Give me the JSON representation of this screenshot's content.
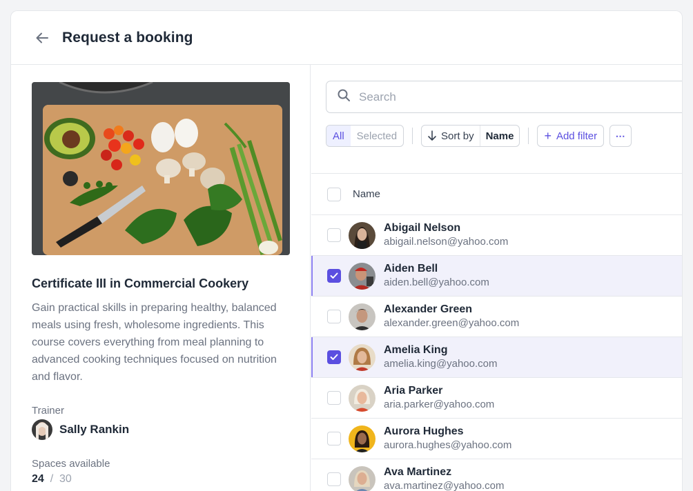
{
  "header": {
    "title": "Request a booking"
  },
  "course": {
    "title": "Certificate III in Commercial Cookery",
    "description": "Gain practical skills in preparing healthy, balanced meals using fresh, wholesome ingredients. This course covers everything from meal planning to advanced cooking techniques focused on nutrition and flavor.",
    "trainer_label": "Trainer",
    "trainer_name": "Sally Rankin",
    "spaces_label": "Spaces available",
    "spaces_available": "24",
    "spaces_separator": "/",
    "spaces_total": "30"
  },
  "search": {
    "placeholder": "Search",
    "value": ""
  },
  "toolbar": {
    "tab_all": "All",
    "tab_selected": "Selected",
    "active_tab": "All",
    "sort_label": "Sort by",
    "sort_value": "Name",
    "add_filter": "Add filter",
    "more": "⋯"
  },
  "table": {
    "header_name": "Name",
    "rows": [
      {
        "name": "Abigail Nelson",
        "email": "abigail.nelson@yahoo.com",
        "selected": false
      },
      {
        "name": "Aiden Bell",
        "email": "aiden.bell@yahoo.com",
        "selected": true
      },
      {
        "name": "Alexander Green",
        "email": "alexander.green@yahoo.com",
        "selected": false
      },
      {
        "name": "Amelia King",
        "email": "amelia.king@yahoo.com",
        "selected": true
      },
      {
        "name": "Aria Parker",
        "email": "aria.parker@yahoo.com",
        "selected": false
      },
      {
        "name": "Aurora Hughes",
        "email": "aurora.hughes@yahoo.com",
        "selected": false
      },
      {
        "name": "Ava Martinez",
        "email": "ava.martinez@yahoo.com",
        "selected": false
      }
    ]
  },
  "colors": {
    "accent": "#5b4fe0",
    "selected_row": "#f1f1fb"
  }
}
